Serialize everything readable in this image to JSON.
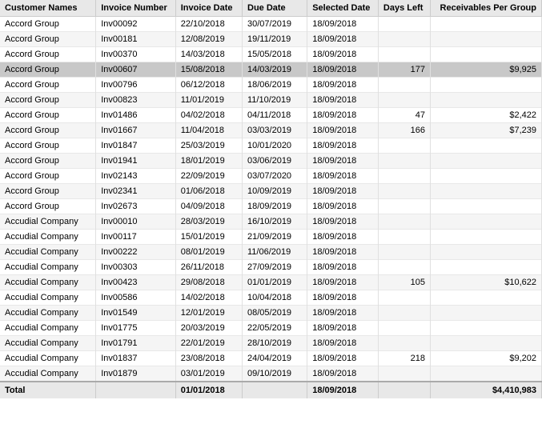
{
  "table": {
    "columns": [
      {
        "label": "Customer Names",
        "key": "customer"
      },
      {
        "label": "Invoice Number",
        "key": "invoice"
      },
      {
        "label": "Invoice Date",
        "key": "invoiceDate"
      },
      {
        "label": "Due Date",
        "key": "dueDate"
      },
      {
        "label": "Selected Date",
        "key": "selectedDate"
      },
      {
        "label": "Days Left",
        "key": "daysLeft"
      },
      {
        "label": "Receivables Per Group",
        "key": "receivables"
      }
    ],
    "rows": [
      {
        "customer": "Accord Group",
        "invoice": "Inv00092",
        "invoiceDate": "22/10/2018",
        "dueDate": "30/07/2019",
        "selectedDate": "18/09/2018",
        "daysLeft": "",
        "receivables": "",
        "highlighted": false
      },
      {
        "customer": "Accord Group",
        "invoice": "Inv00181",
        "invoiceDate": "12/08/2019",
        "dueDate": "19/11/2019",
        "selectedDate": "18/09/2018",
        "daysLeft": "",
        "receivables": "",
        "highlighted": false
      },
      {
        "customer": "Accord Group",
        "invoice": "Inv00370",
        "invoiceDate": "14/03/2018",
        "dueDate": "15/05/2018",
        "selectedDate": "18/09/2018",
        "daysLeft": "",
        "receivables": "",
        "highlighted": false
      },
      {
        "customer": "Accord Group",
        "invoice": "Inv00607",
        "invoiceDate": "15/08/2018",
        "dueDate": "14/03/2019",
        "selectedDate": "18/09/2018",
        "daysLeft": "177",
        "receivables": "$9,925",
        "highlighted": true
      },
      {
        "customer": "Accord Group",
        "invoice": "Inv00796",
        "invoiceDate": "06/12/2018",
        "dueDate": "18/06/2019",
        "selectedDate": "18/09/2018",
        "daysLeft": "",
        "receivables": "",
        "highlighted": false
      },
      {
        "customer": "Accord Group",
        "invoice": "Inv00823",
        "invoiceDate": "11/01/2019",
        "dueDate": "11/10/2019",
        "selectedDate": "18/09/2018",
        "daysLeft": "",
        "receivables": "",
        "highlighted": false
      },
      {
        "customer": "Accord Group",
        "invoice": "Inv01486",
        "invoiceDate": "04/02/2018",
        "dueDate": "04/11/2018",
        "selectedDate": "18/09/2018",
        "daysLeft": "47",
        "receivables": "$2,422",
        "highlighted": false
      },
      {
        "customer": "Accord Group",
        "invoice": "Inv01667",
        "invoiceDate": "11/04/2018",
        "dueDate": "03/03/2019",
        "selectedDate": "18/09/2018",
        "daysLeft": "166",
        "receivables": "$7,239",
        "highlighted": false
      },
      {
        "customer": "Accord Group",
        "invoice": "Inv01847",
        "invoiceDate": "25/03/2019",
        "dueDate": "10/01/2020",
        "selectedDate": "18/09/2018",
        "daysLeft": "",
        "receivables": "",
        "highlighted": false
      },
      {
        "customer": "Accord Group",
        "invoice": "Inv01941",
        "invoiceDate": "18/01/2019",
        "dueDate": "03/06/2019",
        "selectedDate": "18/09/2018",
        "daysLeft": "",
        "receivables": "",
        "highlighted": false
      },
      {
        "customer": "Accord Group",
        "invoice": "Inv02143",
        "invoiceDate": "22/09/2019",
        "dueDate": "03/07/2020",
        "selectedDate": "18/09/2018",
        "daysLeft": "",
        "receivables": "",
        "highlighted": false
      },
      {
        "customer": "Accord Group",
        "invoice": "Inv02341",
        "invoiceDate": "01/06/2018",
        "dueDate": "10/09/2019",
        "selectedDate": "18/09/2018",
        "daysLeft": "",
        "receivables": "",
        "highlighted": false
      },
      {
        "customer": "Accord Group",
        "invoice": "Inv02673",
        "invoiceDate": "04/09/2018",
        "dueDate": "18/09/2019",
        "selectedDate": "18/09/2018",
        "daysLeft": "",
        "receivables": "",
        "highlighted": false
      },
      {
        "customer": "Accudial Company",
        "invoice": "Inv00010",
        "invoiceDate": "28/03/2019",
        "dueDate": "16/10/2019",
        "selectedDate": "18/09/2018",
        "daysLeft": "",
        "receivables": "",
        "highlighted": false
      },
      {
        "customer": "Accudial Company",
        "invoice": "Inv00117",
        "invoiceDate": "15/01/2019",
        "dueDate": "21/09/2019",
        "selectedDate": "18/09/2018",
        "daysLeft": "",
        "receivables": "",
        "highlighted": false
      },
      {
        "customer": "Accudial Company",
        "invoice": "Inv00222",
        "invoiceDate": "08/01/2019",
        "dueDate": "11/06/2019",
        "selectedDate": "18/09/2018",
        "daysLeft": "",
        "receivables": "",
        "highlighted": false
      },
      {
        "customer": "Accudial Company",
        "invoice": "Inv00303",
        "invoiceDate": "26/11/2018",
        "dueDate": "27/09/2019",
        "selectedDate": "18/09/2018",
        "daysLeft": "",
        "receivables": "",
        "highlighted": false
      },
      {
        "customer": "Accudial Company",
        "invoice": "Inv00423",
        "invoiceDate": "29/08/2018",
        "dueDate": "01/01/2019",
        "selectedDate": "18/09/2018",
        "daysLeft": "105",
        "receivables": "$10,622",
        "highlighted": false
      },
      {
        "customer": "Accudial Company",
        "invoice": "Inv00586",
        "invoiceDate": "14/02/2018",
        "dueDate": "10/04/2018",
        "selectedDate": "18/09/2018",
        "daysLeft": "",
        "receivables": "",
        "highlighted": false
      },
      {
        "customer": "Accudial Company",
        "invoice": "Inv01549",
        "invoiceDate": "12/01/2019",
        "dueDate": "08/05/2019",
        "selectedDate": "18/09/2018",
        "daysLeft": "",
        "receivables": "",
        "highlighted": false
      },
      {
        "customer": "Accudial Company",
        "invoice": "Inv01775",
        "invoiceDate": "20/03/2019",
        "dueDate": "22/05/2019",
        "selectedDate": "18/09/2018",
        "daysLeft": "",
        "receivables": "",
        "highlighted": false
      },
      {
        "customer": "Accudial Company",
        "invoice": "Inv01791",
        "invoiceDate": "22/01/2019",
        "dueDate": "28/10/2019",
        "selectedDate": "18/09/2018",
        "daysLeft": "",
        "receivables": "",
        "highlighted": false
      },
      {
        "customer": "Accudial Company",
        "invoice": "Inv01837",
        "invoiceDate": "23/08/2018",
        "dueDate": "24/04/2019",
        "selectedDate": "18/09/2018",
        "daysLeft": "218",
        "receivables": "$9,202",
        "highlighted": false
      },
      {
        "customer": "Accudial Company",
        "invoice": "Inv01879",
        "invoiceDate": "03/01/2019",
        "dueDate": "09/10/2019",
        "selectedDate": "18/09/2018",
        "daysLeft": "",
        "receivables": "",
        "highlighted": false
      }
    ],
    "footer": {
      "label": "Total",
      "invoiceDate": "01/01/2018",
      "selectedDate": "18/09/2018",
      "receivables": "$4,410,983"
    }
  }
}
